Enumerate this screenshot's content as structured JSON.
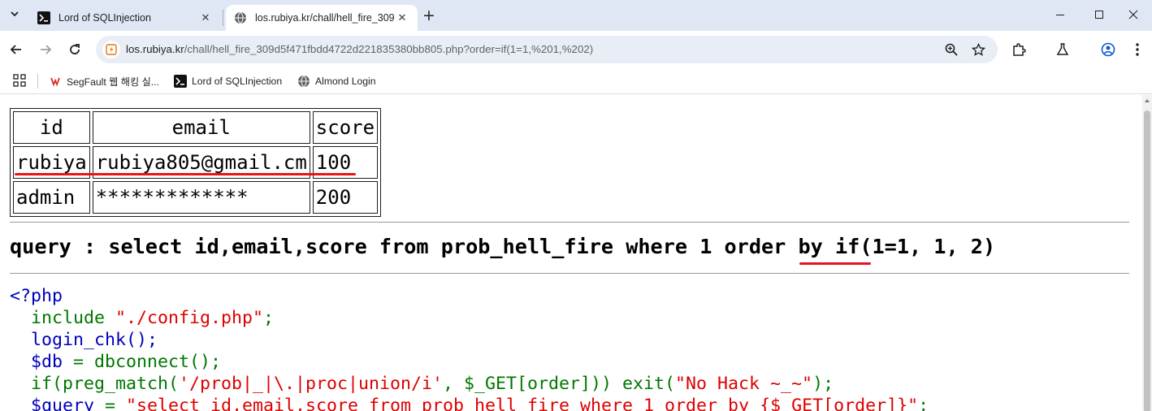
{
  "tabs": [
    {
      "title": "Lord of SQLInjection",
      "active": false,
      "icon": "terminal-icon"
    },
    {
      "title": "los.rubiya.kr/chall/hell_fire_309",
      "active": true,
      "icon": "globe-icon"
    }
  ],
  "address_bar": {
    "host": "los.rubiya.kr",
    "path": "/chall/hell_fire_309d5f471fbdd4722d221835380bb805.php?order=if(1=1,%201,%202)"
  },
  "bookmarks": [
    {
      "label": "SegFault 웹 해킹 실...",
      "icon": "segfault-icon"
    },
    {
      "label": "Lord of SQLInjection",
      "icon": "terminal-icon"
    },
    {
      "label": "Almond Login",
      "icon": "globe-icon"
    }
  ],
  "result_table": {
    "headers": [
      "id",
      "email",
      "score"
    ],
    "rows": [
      [
        "rubiya",
        "rubiya805@gmail.cm",
        "100"
      ],
      [
        "admin",
        "*************",
        "200"
      ]
    ]
  },
  "query": "query : select id,email,score from prob_hell_fire where 1 order by if(1=1, 1, 2)",
  "source_code": {
    "line1": "<?php",
    "line2_kw": "  include ",
    "line2_str": "\"./config.php\"",
    "line2_end": ";",
    "line3": "  login_chk();",
    "line4_var": "  $db ",
    "line4_rest": "= dbconnect();",
    "line5_a": "  if(preg_match(",
    "line5_str": "'/prob|_|\\.|proc|union/i'",
    "line5_b": ", $_GET[order])) exit(",
    "line5_str2": "\"No Hack ~_~\"",
    "line5_c": ");",
    "line6_var": "  $query ",
    "line6_eq": "= ",
    "line6_str": "\"select id,email,score from prob_hell_fire where 1 order by {$_GET[order]}\"",
    "line6_end": ";"
  },
  "colors": {
    "php_keyword": "#007700",
    "php_string": "#dd0000",
    "php_default": "#0000bb",
    "annotation": "#e8141c"
  }
}
